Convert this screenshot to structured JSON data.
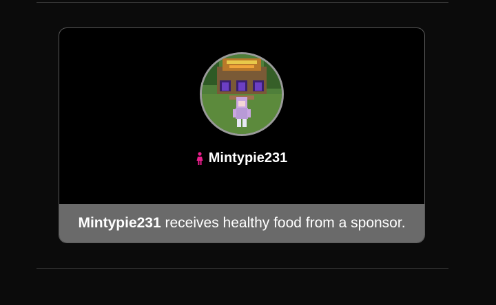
{
  "tribute": {
    "name": "Mintypie231",
    "gender_icon": "female-icon",
    "gender_color": "#e91e8c"
  },
  "event": {
    "subject": "Mintypie231",
    "text": " receives healthy food from a sponsor."
  }
}
